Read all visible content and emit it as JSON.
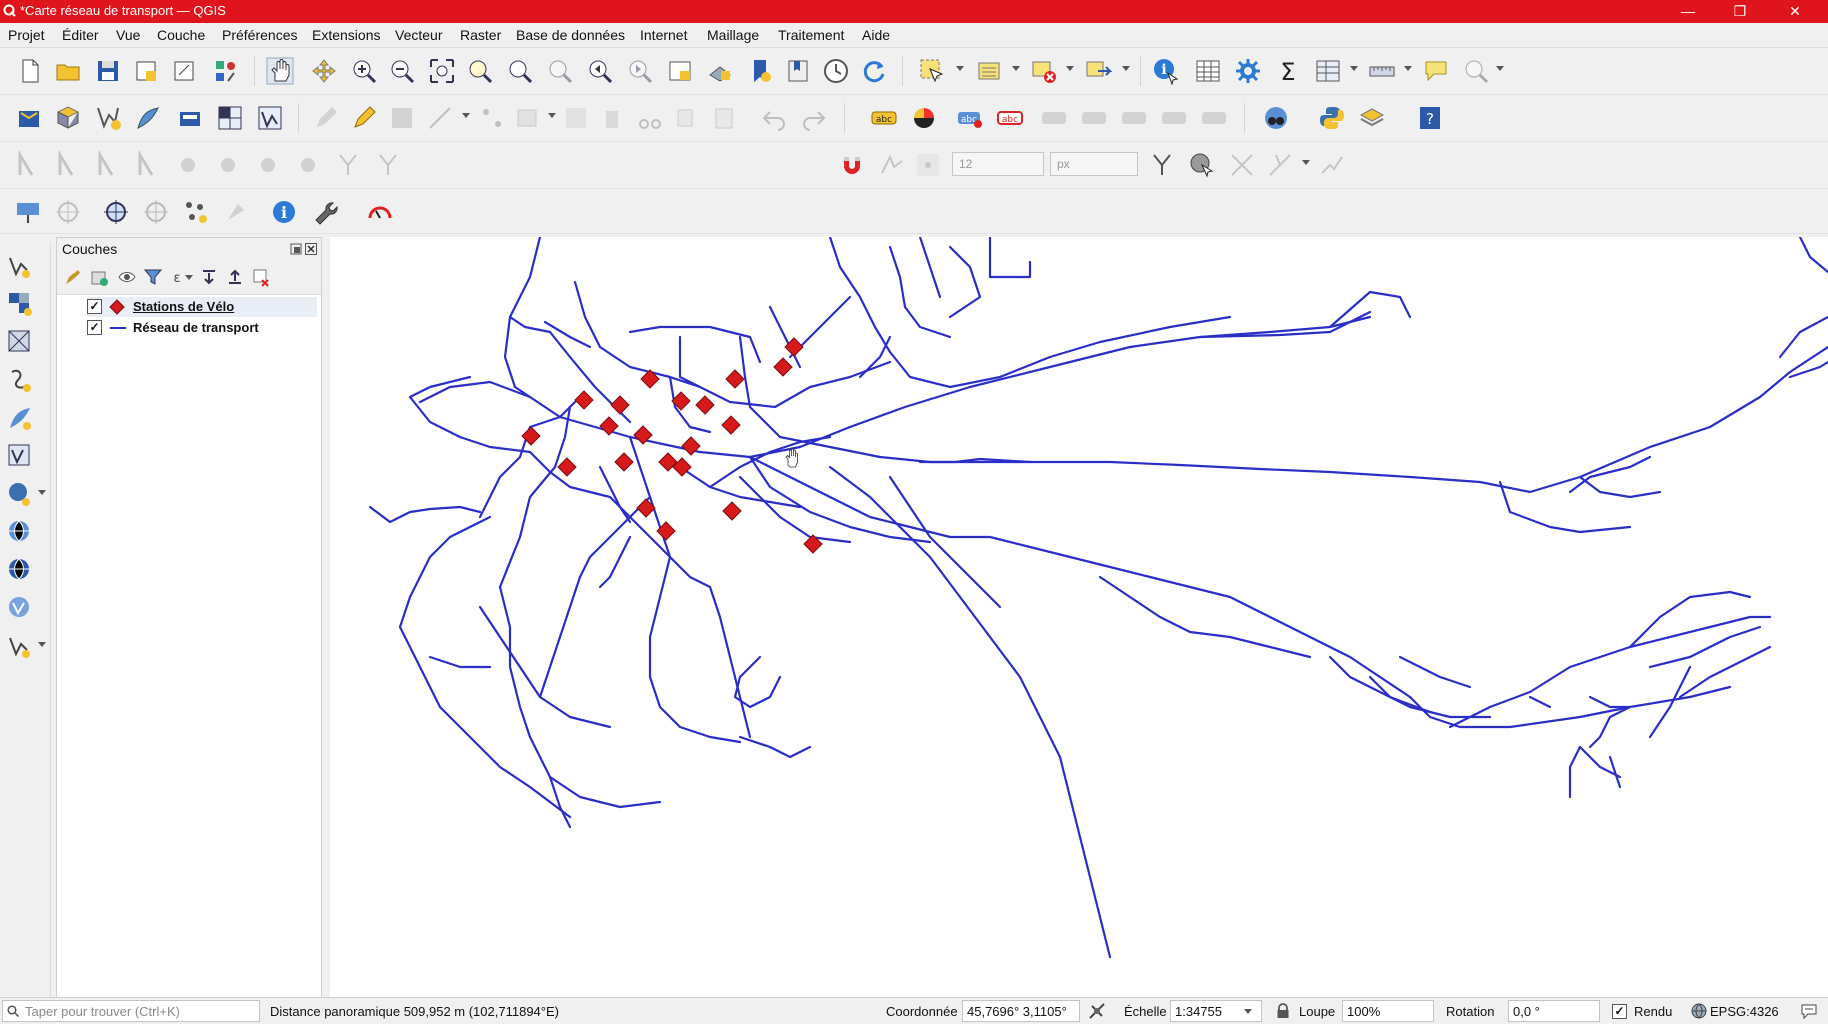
{
  "window": {
    "title": "*Carte réseau de transport — QGIS"
  },
  "menu": [
    "Projet",
    "Éditer",
    "Vue",
    "Couche",
    "Préférences",
    "Extensions",
    "Vecteur",
    "Raster",
    "Base de données",
    "Internet",
    "Maillage",
    "Traitement",
    "Aide"
  ],
  "digitize": {
    "tolerance_value": "12",
    "unit_value": "px"
  },
  "layers_panel": {
    "title": "Couches",
    "layers": [
      {
        "name": "Stations de Vélo",
        "checked": "✓",
        "symbol": "red-diamond"
      },
      {
        "name": "Réseau de transport",
        "checked": "✓",
        "symbol": "blue-line"
      }
    ]
  },
  "colors": {
    "title_bar": "#e0141d",
    "network": "#2a2ec6",
    "stations": "#d7191c"
  },
  "status": {
    "search_placeholder": "Taper pour trouver (Ctrl+K)",
    "message": "Distance panoramique 509,952 m (102,711894°E)",
    "coordinate_label": "Coordonnée",
    "coordinate_value": "45,7696° 3,1105°",
    "scale_label": "Échelle",
    "scale_value": "1:34755",
    "magnifier_label": "Loupe",
    "magnifier_value": "100%",
    "rotation_label": "Rotation",
    "rotation_value": "0,0 °",
    "render_label": "Rendu",
    "render_checked": "✓",
    "crs": "EPSG:4326"
  }
}
